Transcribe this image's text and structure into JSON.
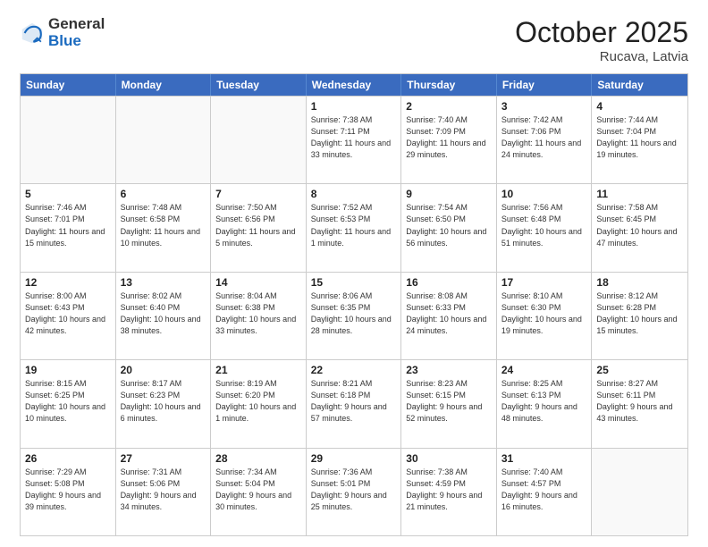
{
  "logo": {
    "general": "General",
    "blue": "Blue"
  },
  "title": "October 2025",
  "location": "Rucava, Latvia",
  "days_of_week": [
    "Sunday",
    "Monday",
    "Tuesday",
    "Wednesday",
    "Thursday",
    "Friday",
    "Saturday"
  ],
  "weeks": [
    [
      {
        "day": "",
        "sunrise": "",
        "sunset": "",
        "daylight": ""
      },
      {
        "day": "",
        "sunrise": "",
        "sunset": "",
        "daylight": ""
      },
      {
        "day": "",
        "sunrise": "",
        "sunset": "",
        "daylight": ""
      },
      {
        "day": "1",
        "sunrise": "Sunrise: 7:38 AM",
        "sunset": "Sunset: 7:11 PM",
        "daylight": "Daylight: 11 hours and 33 minutes."
      },
      {
        "day": "2",
        "sunrise": "Sunrise: 7:40 AM",
        "sunset": "Sunset: 7:09 PM",
        "daylight": "Daylight: 11 hours and 29 minutes."
      },
      {
        "day": "3",
        "sunrise": "Sunrise: 7:42 AM",
        "sunset": "Sunset: 7:06 PM",
        "daylight": "Daylight: 11 hours and 24 minutes."
      },
      {
        "day": "4",
        "sunrise": "Sunrise: 7:44 AM",
        "sunset": "Sunset: 7:04 PM",
        "daylight": "Daylight: 11 hours and 19 minutes."
      }
    ],
    [
      {
        "day": "5",
        "sunrise": "Sunrise: 7:46 AM",
        "sunset": "Sunset: 7:01 PM",
        "daylight": "Daylight: 11 hours and 15 minutes."
      },
      {
        "day": "6",
        "sunrise": "Sunrise: 7:48 AM",
        "sunset": "Sunset: 6:58 PM",
        "daylight": "Daylight: 11 hours and 10 minutes."
      },
      {
        "day": "7",
        "sunrise": "Sunrise: 7:50 AM",
        "sunset": "Sunset: 6:56 PM",
        "daylight": "Daylight: 11 hours and 5 minutes."
      },
      {
        "day": "8",
        "sunrise": "Sunrise: 7:52 AM",
        "sunset": "Sunset: 6:53 PM",
        "daylight": "Daylight: 11 hours and 1 minute."
      },
      {
        "day": "9",
        "sunrise": "Sunrise: 7:54 AM",
        "sunset": "Sunset: 6:50 PM",
        "daylight": "Daylight: 10 hours and 56 minutes."
      },
      {
        "day": "10",
        "sunrise": "Sunrise: 7:56 AM",
        "sunset": "Sunset: 6:48 PM",
        "daylight": "Daylight: 10 hours and 51 minutes."
      },
      {
        "day": "11",
        "sunrise": "Sunrise: 7:58 AM",
        "sunset": "Sunset: 6:45 PM",
        "daylight": "Daylight: 10 hours and 47 minutes."
      }
    ],
    [
      {
        "day": "12",
        "sunrise": "Sunrise: 8:00 AM",
        "sunset": "Sunset: 6:43 PM",
        "daylight": "Daylight: 10 hours and 42 minutes."
      },
      {
        "day": "13",
        "sunrise": "Sunrise: 8:02 AM",
        "sunset": "Sunset: 6:40 PM",
        "daylight": "Daylight: 10 hours and 38 minutes."
      },
      {
        "day": "14",
        "sunrise": "Sunrise: 8:04 AM",
        "sunset": "Sunset: 6:38 PM",
        "daylight": "Daylight: 10 hours and 33 minutes."
      },
      {
        "day": "15",
        "sunrise": "Sunrise: 8:06 AM",
        "sunset": "Sunset: 6:35 PM",
        "daylight": "Daylight: 10 hours and 28 minutes."
      },
      {
        "day": "16",
        "sunrise": "Sunrise: 8:08 AM",
        "sunset": "Sunset: 6:33 PM",
        "daylight": "Daylight: 10 hours and 24 minutes."
      },
      {
        "day": "17",
        "sunrise": "Sunrise: 8:10 AM",
        "sunset": "Sunset: 6:30 PM",
        "daylight": "Daylight: 10 hours and 19 minutes."
      },
      {
        "day": "18",
        "sunrise": "Sunrise: 8:12 AM",
        "sunset": "Sunset: 6:28 PM",
        "daylight": "Daylight: 10 hours and 15 minutes."
      }
    ],
    [
      {
        "day": "19",
        "sunrise": "Sunrise: 8:15 AM",
        "sunset": "Sunset: 6:25 PM",
        "daylight": "Daylight: 10 hours and 10 minutes."
      },
      {
        "day": "20",
        "sunrise": "Sunrise: 8:17 AM",
        "sunset": "Sunset: 6:23 PM",
        "daylight": "Daylight: 10 hours and 6 minutes."
      },
      {
        "day": "21",
        "sunrise": "Sunrise: 8:19 AM",
        "sunset": "Sunset: 6:20 PM",
        "daylight": "Daylight: 10 hours and 1 minute."
      },
      {
        "day": "22",
        "sunrise": "Sunrise: 8:21 AM",
        "sunset": "Sunset: 6:18 PM",
        "daylight": "Daylight: 9 hours and 57 minutes."
      },
      {
        "day": "23",
        "sunrise": "Sunrise: 8:23 AM",
        "sunset": "Sunset: 6:15 PM",
        "daylight": "Daylight: 9 hours and 52 minutes."
      },
      {
        "day": "24",
        "sunrise": "Sunrise: 8:25 AM",
        "sunset": "Sunset: 6:13 PM",
        "daylight": "Daylight: 9 hours and 48 minutes."
      },
      {
        "day": "25",
        "sunrise": "Sunrise: 8:27 AM",
        "sunset": "Sunset: 6:11 PM",
        "daylight": "Daylight: 9 hours and 43 minutes."
      }
    ],
    [
      {
        "day": "26",
        "sunrise": "Sunrise: 7:29 AM",
        "sunset": "Sunset: 5:08 PM",
        "daylight": "Daylight: 9 hours and 39 minutes."
      },
      {
        "day": "27",
        "sunrise": "Sunrise: 7:31 AM",
        "sunset": "Sunset: 5:06 PM",
        "daylight": "Daylight: 9 hours and 34 minutes."
      },
      {
        "day": "28",
        "sunrise": "Sunrise: 7:34 AM",
        "sunset": "Sunset: 5:04 PM",
        "daylight": "Daylight: 9 hours and 30 minutes."
      },
      {
        "day": "29",
        "sunrise": "Sunrise: 7:36 AM",
        "sunset": "Sunset: 5:01 PM",
        "daylight": "Daylight: 9 hours and 25 minutes."
      },
      {
        "day": "30",
        "sunrise": "Sunrise: 7:38 AM",
        "sunset": "Sunset: 4:59 PM",
        "daylight": "Daylight: 9 hours and 21 minutes."
      },
      {
        "day": "31",
        "sunrise": "Sunrise: 7:40 AM",
        "sunset": "Sunset: 4:57 PM",
        "daylight": "Daylight: 9 hours and 16 minutes."
      },
      {
        "day": "",
        "sunrise": "",
        "sunset": "",
        "daylight": ""
      }
    ]
  ]
}
